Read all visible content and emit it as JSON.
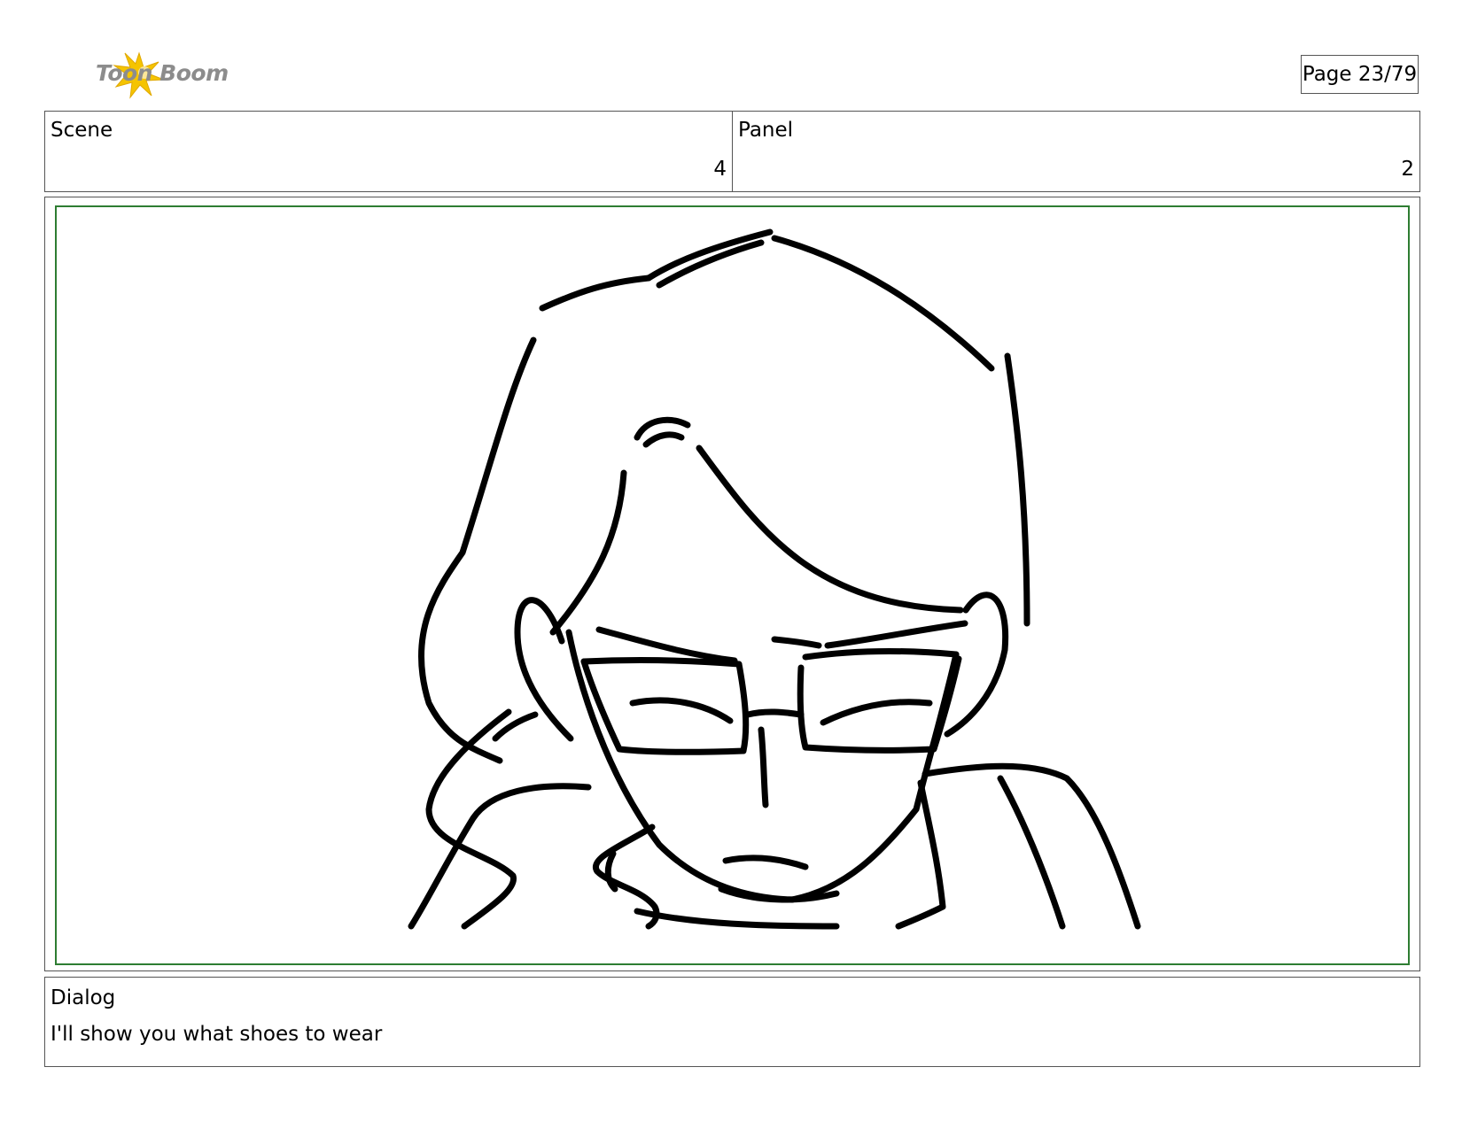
{
  "header": {
    "logo_text": "Toon Boom",
    "page_indicator": "Page 23/79"
  },
  "info": {
    "scene_label": "Scene",
    "scene_value": "4",
    "panel_label": "Panel",
    "panel_value": "2"
  },
  "dialog": {
    "label": "Dialog",
    "text": "I'll show you what shoes to wear"
  },
  "colors": {
    "frame_border": "#2e7d32",
    "logo_star": "#f5c400",
    "logo_text": "#8c8c8c"
  }
}
